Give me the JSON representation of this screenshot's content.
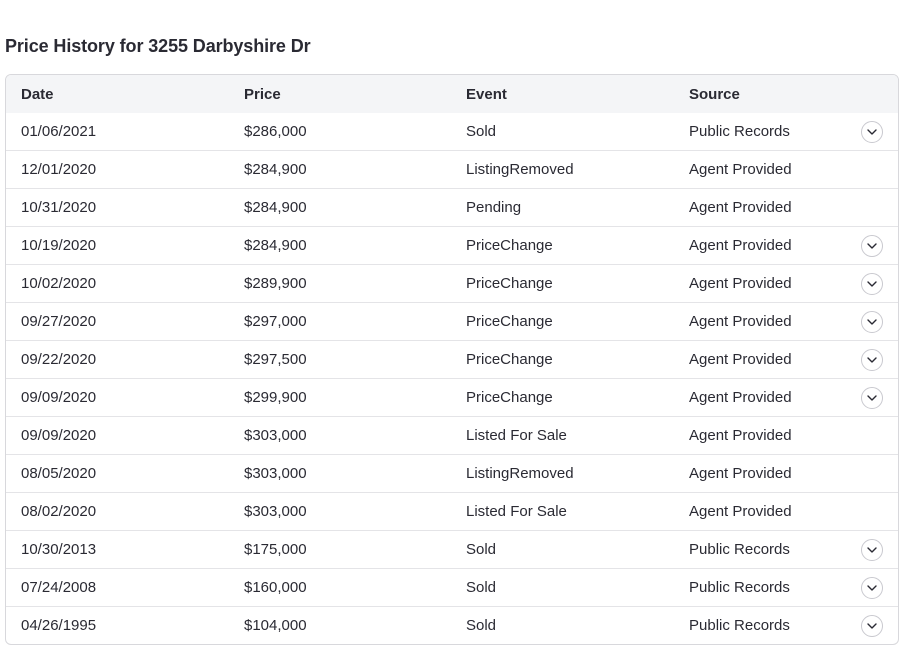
{
  "page": {
    "title": "Price History for 3255 Darbyshire Dr"
  },
  "table": {
    "headers": {
      "date": "Date",
      "price": "Price",
      "event": "Event",
      "source": "Source"
    },
    "rows": [
      {
        "date": "01/06/2021",
        "price": "$286,000",
        "event": "Sold",
        "source": "Public Records",
        "expandable": true
      },
      {
        "date": "12/01/2020",
        "price": "$284,900",
        "event": "ListingRemoved",
        "source": "Agent Provided",
        "expandable": false
      },
      {
        "date": "10/31/2020",
        "price": "$284,900",
        "event": "Pending",
        "source": "Agent Provided",
        "expandable": false
      },
      {
        "date": "10/19/2020",
        "price": "$284,900",
        "event": "PriceChange",
        "source": "Agent Provided",
        "expandable": true
      },
      {
        "date": "10/02/2020",
        "price": "$289,900",
        "event": "PriceChange",
        "source": "Agent Provided",
        "expandable": true
      },
      {
        "date": "09/27/2020",
        "price": "$297,000",
        "event": "PriceChange",
        "source": "Agent Provided",
        "expandable": true
      },
      {
        "date": "09/22/2020",
        "price": "$297,500",
        "event": "PriceChange",
        "source": "Agent Provided",
        "expandable": true
      },
      {
        "date": "09/09/2020",
        "price": "$299,900",
        "event": "PriceChange",
        "source": "Agent Provided",
        "expandable": true
      },
      {
        "date": "09/09/2020",
        "price": "$303,000",
        "event": "Listed For Sale",
        "source": "Agent Provided",
        "expandable": false
      },
      {
        "date": "08/05/2020",
        "price": "$303,000",
        "event": "ListingRemoved",
        "source": "Agent Provided",
        "expandable": false
      },
      {
        "date": "08/02/2020",
        "price": "$303,000",
        "event": "Listed For Sale",
        "source": "Agent Provided",
        "expandable": false
      },
      {
        "date": "10/30/2013",
        "price": "$175,000",
        "event": "Sold",
        "source": "Public Records",
        "expandable": true
      },
      {
        "date": "07/24/2008",
        "price": "$160,000",
        "event": "Sold",
        "source": "Public Records",
        "expandable": true
      },
      {
        "date": "04/26/1995",
        "price": "$104,000",
        "event": "Sold",
        "source": "Public Records",
        "expandable": true
      }
    ],
    "expand_icon": "chevron-down-icon"
  },
  "colors": {
    "text": "#2a2a33",
    "header_bg": "#f4f5f7",
    "border": "#d8d8dc"
  }
}
